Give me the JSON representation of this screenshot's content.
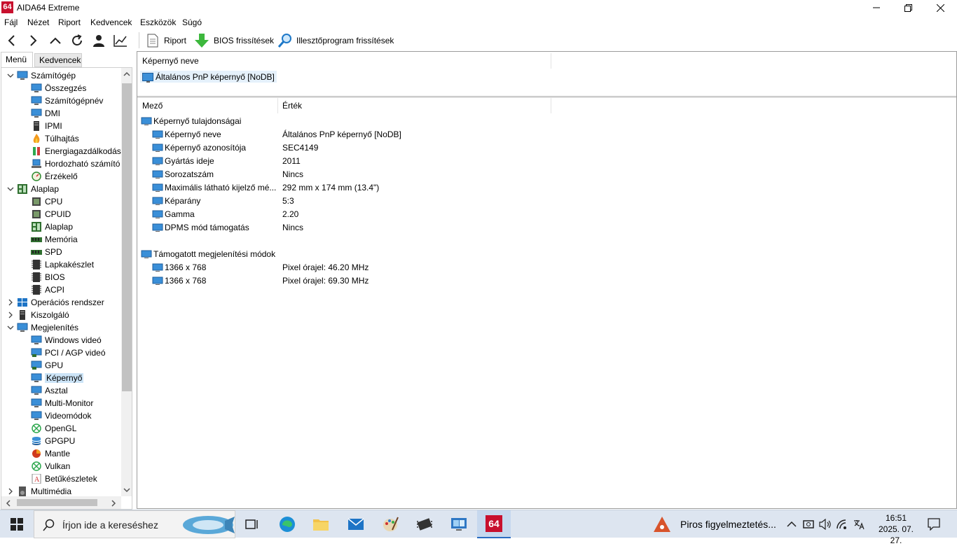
{
  "window": {
    "logo": "64",
    "title": "AIDA64 Extreme"
  },
  "menu": [
    "Fájl",
    "Nézet",
    "Riport",
    "Kedvencek",
    "Eszközök",
    "Súgó"
  ],
  "toolbar": {
    "report": "Riport",
    "bios": "BIOS frissítések",
    "driver": "Illesztőprogram frissítések"
  },
  "tabs": {
    "menu": "Menü",
    "favorites": "Kedvencek"
  },
  "tree": [
    {
      "label": "Számítógép",
      "icon": "computer-icon",
      "level": 0,
      "expanded": true
    },
    {
      "label": "Összegzés",
      "icon": "monitor-icon",
      "level": 1
    },
    {
      "label": "Számítógépnév",
      "icon": "monitor-icon",
      "level": 1
    },
    {
      "label": "DMI",
      "icon": "monitor-icon",
      "level": 1
    },
    {
      "label": "IPMI",
      "icon": "server-icon",
      "level": 1
    },
    {
      "label": "Túlhajtás",
      "icon": "flame-icon",
      "level": 1
    },
    {
      "label": "Energiagazdálkodás",
      "icon": "battery-icon",
      "level": 1
    },
    {
      "label": "Hordozható számító",
      "icon": "laptop-icon",
      "level": 1
    },
    {
      "label": "Érzékelő",
      "icon": "gauge-icon",
      "level": 1
    },
    {
      "label": "Alaplap",
      "icon": "motherboard-icon",
      "level": 0,
      "expanded": true
    },
    {
      "label": "CPU",
      "icon": "chip-icon",
      "level": 1
    },
    {
      "label": "CPUID",
      "icon": "chip-icon",
      "level": 1
    },
    {
      "label": "Alaplap",
      "icon": "motherboard-icon",
      "level": 1
    },
    {
      "label": "Memória",
      "icon": "ram-icon",
      "level": 1
    },
    {
      "label": "SPD",
      "icon": "ram-icon",
      "level": 1
    },
    {
      "label": "Lapkakészlet",
      "icon": "chipset-icon",
      "level": 1
    },
    {
      "label": "BIOS",
      "icon": "chipset-icon",
      "level": 1
    },
    {
      "label": "ACPI",
      "icon": "chipset-icon",
      "level": 1
    },
    {
      "label": "Operációs rendszer",
      "icon": "windows-icon",
      "level": 0,
      "expanded": false
    },
    {
      "label": "Kiszolgáló",
      "icon": "server-icon",
      "level": 0,
      "expanded": false
    },
    {
      "label": "Megjelenítés",
      "icon": "monitor-icon",
      "level": 0,
      "expanded": true
    },
    {
      "label": "Windows videó",
      "icon": "monitor-icon",
      "level": 1
    },
    {
      "label": "PCI / AGP videó",
      "icon": "gpu-icon",
      "level": 1
    },
    {
      "label": "GPU",
      "icon": "gpu-icon",
      "level": 1
    },
    {
      "label": "Képernyő",
      "icon": "monitor-icon",
      "level": 1,
      "selected": true
    },
    {
      "label": "Asztal",
      "icon": "monitor-icon",
      "level": 1
    },
    {
      "label": "Multi-Monitor",
      "icon": "monitor-icon",
      "level": 1
    },
    {
      "label": "Videomódok",
      "icon": "monitor-icon",
      "level": 1
    },
    {
      "label": "OpenGL",
      "icon": "xbox-icon",
      "level": 1
    },
    {
      "label": "GPGPU",
      "icon": "database-icon",
      "level": 1
    },
    {
      "label": "Mantle",
      "icon": "mantle-icon",
      "level": 1
    },
    {
      "label": "Vulkan",
      "icon": "xbox-icon",
      "level": 1
    },
    {
      "label": "Betűkészletek",
      "icon": "font-icon",
      "level": 1
    },
    {
      "label": "Multimédia",
      "icon": "speaker-icon",
      "level": 0,
      "expanded": false
    }
  ],
  "top_list": {
    "header": "Képernyő neve",
    "item": "Általános PnP képernyő [NoDB]"
  },
  "detail": {
    "col_field": "Mező",
    "col_value": "Érték",
    "sections": [
      {
        "title": "Képernyő tulajdonságai",
        "rows": [
          {
            "field": "Képernyő neve",
            "value": "Általános PnP képernyő [NoDB]"
          },
          {
            "field": "Képernyő azonosítója",
            "value": "SEC4149"
          },
          {
            "field": "Gyártás ideje",
            "value": "2011"
          },
          {
            "field": "Sorozatszám",
            "value": "Nincs"
          },
          {
            "field": "Maximális látható kijelző mé...",
            "value": "292 mm x 174 mm (13.4\")"
          },
          {
            "field": "Képarány",
            "value": "5:3"
          },
          {
            "field": "Gamma",
            "value": "2.20"
          },
          {
            "field": "DPMS mód támogatás",
            "value": "Nincs"
          }
        ]
      },
      {
        "title": "Támogatott megjelenítési módok",
        "rows": [
          {
            "field": "1366 x 768",
            "value": "Pixel órajel: 46.20 MHz"
          },
          {
            "field": "1366 x 768",
            "value": "Pixel órajel: 69.30 MHz"
          }
        ]
      }
    ]
  },
  "taskbar": {
    "search_placeholder": "Írjon ide a kereséshez",
    "notification": "Piros figyelmeztetés...",
    "time": "16:51",
    "date": "2025. 07. 27.",
    "app_badge": "64"
  }
}
